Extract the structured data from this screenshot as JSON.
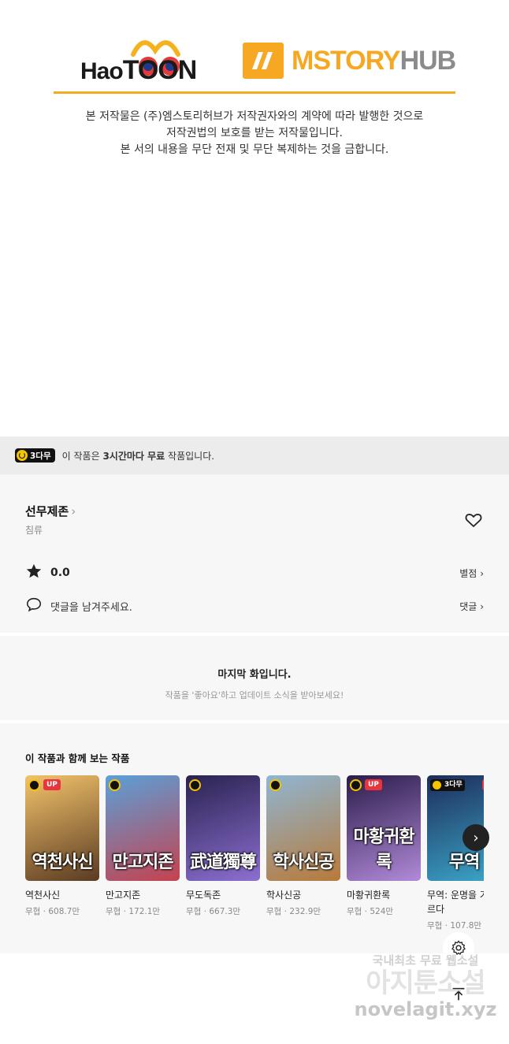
{
  "copyright": {
    "logo_left": "HaoTOON",
    "logo_left_prefix": "Hao",
    "logo_left_suffix": "TOON",
    "logo_right_main": "MSTORY",
    "logo_right_suffix": "HUB",
    "line1": "본 저작물은 (주)엠스토리허브가 저작권자와의 계약에 따라 발행한 것으로",
    "line2": "저작권법의 보호를 받는 저작물입니다.",
    "line3": "본 서의 내용을 무단 전재 및 무단 복제하는 것을 금합니다."
  },
  "free_banner": {
    "badge": "3다무",
    "text_pre": "이 작품은 ",
    "text_bold": "3시간마다 무료",
    "text_post": " 작품입니다."
  },
  "series": {
    "title": "선무제존",
    "genre": "침류",
    "rating": "0.0",
    "rating_link": "별점",
    "comment_placeholder": "댓글을 남겨주세요.",
    "comment_link": "댓글"
  },
  "last_episode": {
    "title": "마지막 화입니다.",
    "subtitle": "작품을 '좋아요'하고 업데이트 소식을 받아보세요!"
  },
  "recommend": {
    "heading": "이 작품과 함께 보는 작품",
    "items": [
      {
        "name": "역천사신",
        "meta": "무협 · 608.7만",
        "cover": "역천사신",
        "badge": "UP",
        "bg1": "#f3c36b",
        "bg2": "#5a3b22"
      },
      {
        "name": "만고지존",
        "meta": "무협 · 172.1만",
        "cover": "만고지존",
        "badge": "",
        "bg1": "#5aa0d8",
        "bg2": "#c5424f"
      },
      {
        "name": "무도독존",
        "meta": "무협 · 667.3만",
        "cover": "武道獨尊",
        "badge": "",
        "bg1": "#2a2250",
        "bg2": "#8c6fd1"
      },
      {
        "name": "학사신공",
        "meta": "무협 · 232.9만",
        "cover": "학사신공",
        "badge": "",
        "bg1": "#8fb6d3",
        "bg2": "#b87a3a"
      },
      {
        "name": "마황귀환록",
        "meta": "무협 · 524만",
        "cover": "마황귀환록",
        "badge": "UP",
        "bg1": "#2b1d4a",
        "bg2": "#b18ad9"
      },
      {
        "name": "무역: 운명을 거스르다",
        "meta": "무협 · 107.8만",
        "cover": "무역",
        "badge": "UP",
        "wait": "3다무",
        "bg1": "#1d2c5a",
        "bg2": "#3ba7c9"
      }
    ]
  },
  "icons": {
    "heart": "heart-outline-icon",
    "star": "star-icon",
    "comment": "comment-bubble-icon",
    "settings": "gear-icon",
    "scroll_top": "arrow-up-icon",
    "next": "chevron-right-icon"
  },
  "watermark": {
    "line1": "국내최초 무료 웹소설",
    "line2": "아지툰소설",
    "line3": "novelagit.xyz"
  },
  "colors": {
    "accent_gold": "#f2ad1e",
    "badge_red": "#e8343c",
    "banner_bg": "#ececec"
  }
}
